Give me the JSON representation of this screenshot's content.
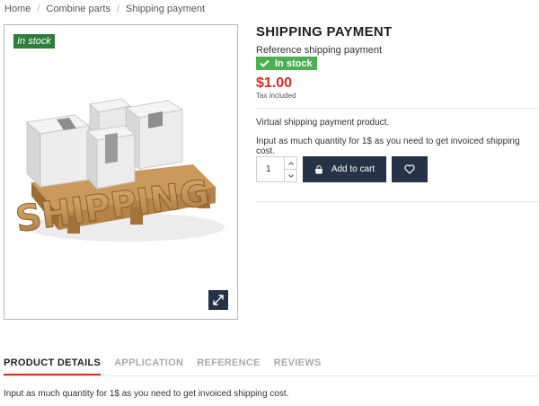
{
  "breadcrumb": [
    "Home",
    "Combine parts",
    "Shipping payment"
  ],
  "image": {
    "tag": "In stock",
    "scene_text": "SHIPPING"
  },
  "product": {
    "title": "SHIPPING PAYMENT",
    "reference": "Reference shipping payment",
    "availability": "In stock",
    "price": "$1.00",
    "tax_label": "Tax included",
    "description": "Virtual shipping payment product.",
    "instructions": "Input as much quantity for 1$ as you need to get invoiced shipping cost."
  },
  "purchase": {
    "quantity": "1",
    "add_to_cart_label": "Add to cart"
  },
  "tabs": [
    {
      "label": "PRODUCT DETAILS",
      "active": true
    },
    {
      "label": "APPLICATION",
      "active": false
    },
    {
      "label": "REFERENCE",
      "active": false
    },
    {
      "label": "REVIEWS",
      "active": false
    }
  ],
  "tab_content": "Input as much quantity for 1$ as you need to get invoiced shipping cost.",
  "colors": {
    "accent_dark": "#263245",
    "price_red": "#e02a20",
    "stock_green": "#4caf50",
    "tag_green": "#2e7d3a"
  }
}
